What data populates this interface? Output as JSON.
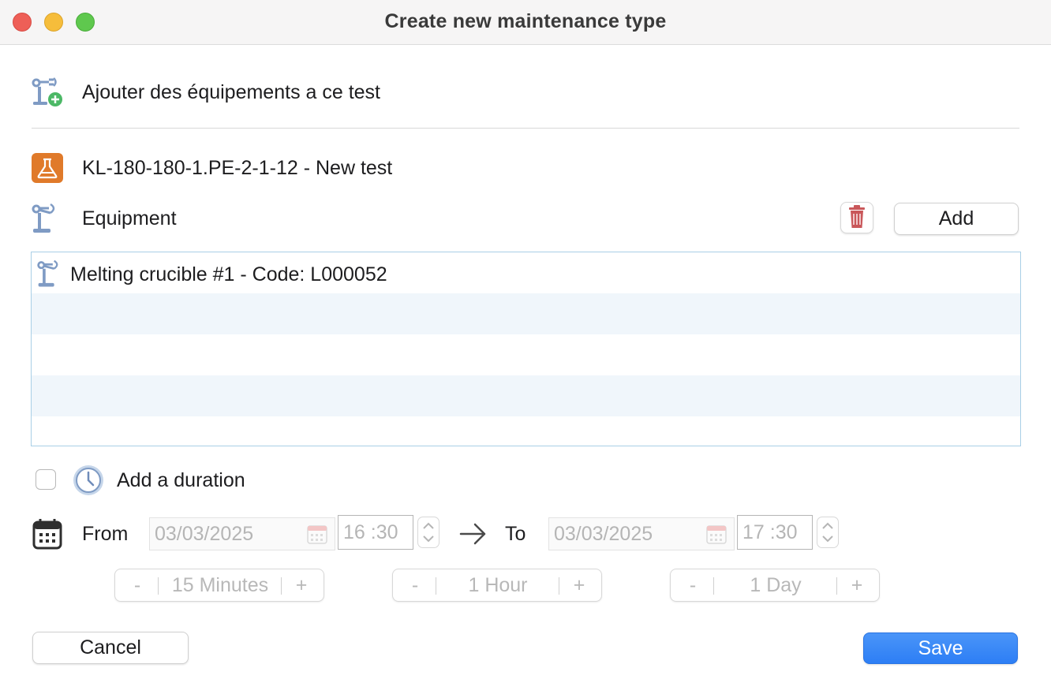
{
  "window": {
    "title": "Create new maintenance type"
  },
  "header": {
    "add_equipment_text": "Ajouter des équipements a ce test"
  },
  "test": {
    "name": "KL-180-180-1.PE-2-1-12 - New test"
  },
  "equipment": {
    "label": "Equipment",
    "add_label": "Add",
    "items": [
      {
        "label": "Melting crucible #1 - Code: L000052"
      }
    ]
  },
  "duration": {
    "label": "Add a duration",
    "checked": false,
    "from_label": "From",
    "to_label": "To",
    "from_date": "03/03/2025",
    "from_time": "16 :30",
    "to_date": "03/03/2025",
    "to_time": "17 :30",
    "increments": [
      {
        "minus": "-",
        "label": "15 Minutes",
        "plus": "+"
      },
      {
        "minus": "-",
        "label": "1 Hour",
        "plus": "+"
      },
      {
        "minus": "-",
        "label": "1 Day",
        "plus": "+"
      }
    ]
  },
  "actions": {
    "cancel": "Cancel",
    "save": "Save"
  },
  "colors": {
    "accent": "#2d7ef5",
    "icon_blue": "#7f9bc4",
    "test_orange": "#e07a2a",
    "trash_red": "#c9575a"
  }
}
